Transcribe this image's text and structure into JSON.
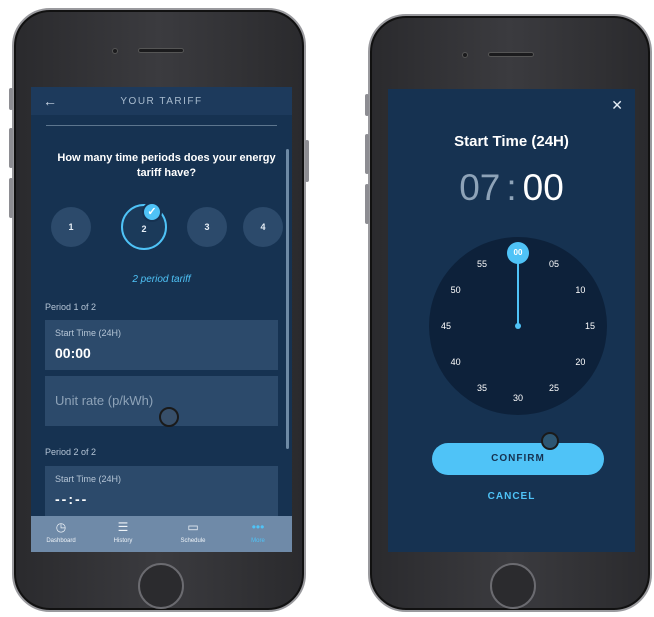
{
  "left_screen": {
    "header": {
      "title": "YOUR TARIFF",
      "back_icon": "arrow-left-icon"
    },
    "question": "How many time periods does your energy tariff have?",
    "period_options": [
      "1",
      "2",
      "3",
      "4"
    ],
    "selected_option": "2",
    "tariff_label": "2 period tariff",
    "period1": {
      "title": "Period 1 of 2",
      "start_label": "Start Time (24H)",
      "start_value": "00:00",
      "rate_placeholder": "Unit rate (p/kWh)"
    },
    "period2": {
      "title": "Period 2 of 2",
      "start_label": "Start Time (24H)",
      "start_value": "--:--"
    },
    "tabs": [
      {
        "label": "Dashboard",
        "icon": "clock-icon"
      },
      {
        "label": "History",
        "icon": "list-icon"
      },
      {
        "label": "Schedule",
        "icon": "calendar-icon"
      },
      {
        "label": "More",
        "icon": "more-dots-icon"
      }
    ],
    "active_tab": "More"
  },
  "right_screen": {
    "title": "Start Time (24H)",
    "hours": "07",
    "separator": ":",
    "minutes": "00",
    "dial_numbers": [
      "00",
      "05",
      "10",
      "15",
      "20",
      "25",
      "30",
      "35",
      "40",
      "45",
      "50",
      "55"
    ],
    "selected_minute": "00",
    "confirm_label": "CONFIRM",
    "cancel_label": "CANCEL",
    "close_icon": "close-icon"
  },
  "colors": {
    "background": "#163251",
    "accent": "#4fc3f7",
    "field": "#2c4a6b",
    "dial": "#0d213a",
    "tabbar": "#6f8aa8"
  }
}
